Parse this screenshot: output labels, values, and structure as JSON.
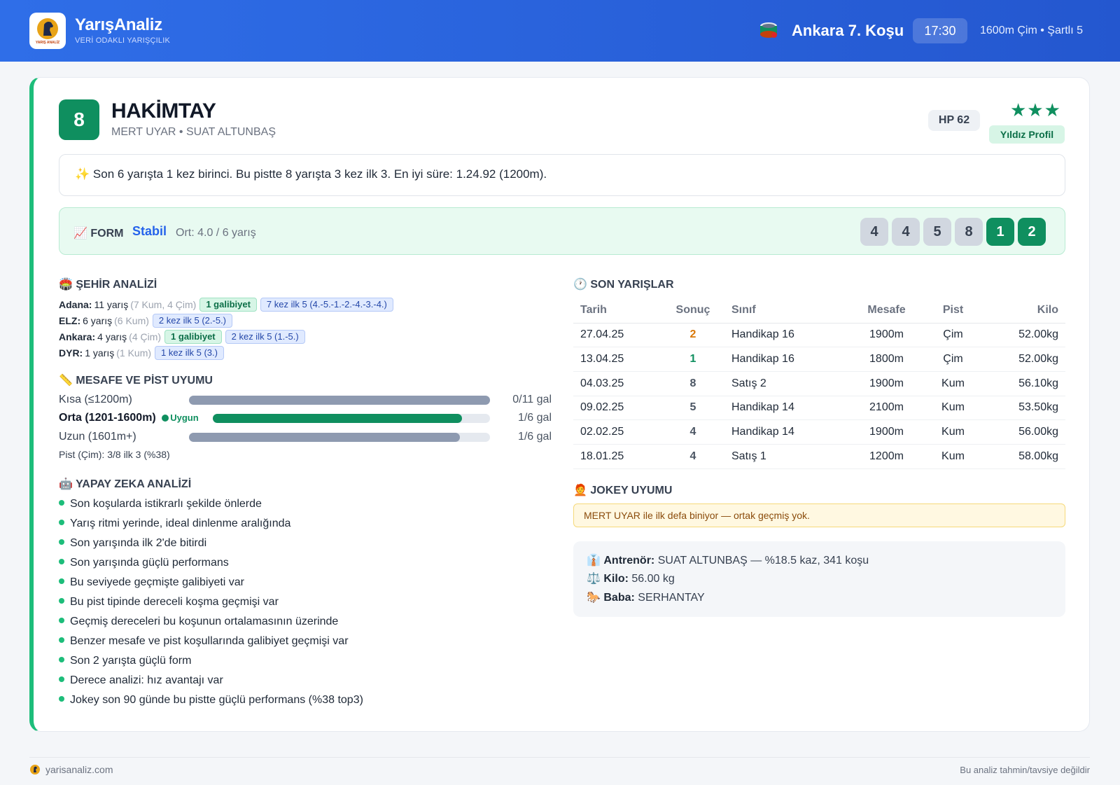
{
  "header": {
    "brand_name": "YarışAnaliz",
    "brand_tagline": "VERİ ODAKLI YARIŞÇILIK",
    "race_title": "Ankara 7. Koşu",
    "race_time": "17:30",
    "race_info": "1600m Çim • Şartlı 5",
    "logo_text": "YARIŞ ANALİZ"
  },
  "horse": {
    "number": "8",
    "name": "HAKİMTAY",
    "jockey_trainer": "MERT UYAR • SUAT ALTUNBAŞ",
    "hp": "HP 62",
    "stars": "★★★",
    "star_count": 3,
    "profile_badge": "Yıldız Profil",
    "summary_icon": "✨",
    "summary": "Son 6 yarışta 1 kez birinci. Bu pistte 8 yarışta 3 kez ilk 3. En iyi süre: 1.24.92 (1200m)."
  },
  "form": {
    "icon": "📈",
    "label": "FORM",
    "status": "Stabil",
    "average": "Ort: 4.0 / 6 yarış",
    "results": [
      "4",
      "4",
      "5",
      "8",
      "1",
      "2"
    ]
  },
  "city_analysis": {
    "icon": "🏟️",
    "title": "ŞEHİR ANALİZİ",
    "rows": [
      {
        "city": "Adana:",
        "races": "11 yarış",
        "detail": "(7 Kum, 4 Çim)",
        "win_tag": "1 galibiyet",
        "top_tag": "7 kez ilk 5 (4.-5.-1.-2.-4.-3.-4.)"
      },
      {
        "city": "ELZ:",
        "races": "6 yarış",
        "detail": "(6 Kum)",
        "win_tag": "",
        "top_tag": "2 kez ilk 5 (2.-5.)"
      },
      {
        "city": "Ankara:",
        "races": "4 yarış",
        "detail": "(4 Çim)",
        "win_tag": "1 galibiyet",
        "top_tag": "2 kez ilk 5 (1.-5.)"
      },
      {
        "city": "DYR:",
        "races": "1 yarış",
        "detail": "(1 Kum)",
        "win_tag": "",
        "top_tag": "1 kez ilk 5 (3.)"
      }
    ]
  },
  "distance": {
    "icon": "📏",
    "title": "MESAFE VE PİST UYUMU",
    "rows": [
      {
        "label": "Kısa (≤1200m)",
        "value": "0/11 gal",
        "fill": 1.0,
        "good": false,
        "badge": ""
      },
      {
        "label": "Orta (1201-1600m)",
        "value": "1/6 gal",
        "fill": 0.9,
        "good": true,
        "badge": "Uygun"
      },
      {
        "label": "Uzun (1601m+)",
        "value": "1/6 gal",
        "fill": 0.9,
        "good": false,
        "badge": ""
      }
    ],
    "pist": "Pist (Çim): 3/8 ilk 3 (%38)"
  },
  "ai": {
    "icon": "🤖",
    "title": "YAPAY ZEKA ANALİZİ",
    "items": [
      "Son koşularda istikrarlı şekilde önlerde",
      "Yarış ritmi yerinde, ideal dinlenme aralığında",
      "Son yarışında ilk 2'de bitirdi",
      "Son yarışında güçlü performans",
      "Bu seviyede geçmişte galibiyeti var",
      "Bu pist tipinde dereceli koşma geçmişi var",
      "Geçmiş dereceleri bu koşunun ortalamasının üzerinde",
      "Benzer mesafe ve pist koşullarında galibiyet geçmişi var",
      "Son 2 yarışta güçlü form",
      "Derece analizi: hız avantajı var",
      "Jokey son 90 günde bu pistte güçlü performans (%38 top3)"
    ]
  },
  "recent": {
    "icon": "🕐",
    "title": "SON YARIŞLAR",
    "headers": [
      "Tarih",
      "Sonuç",
      "Sınıf",
      "Mesafe",
      "Pist",
      "Kilo"
    ],
    "rows": [
      {
        "date": "27.04.25",
        "result": "2",
        "class": "Handikap 16",
        "distance": "1900m",
        "track": "Çim",
        "weight": "52.00kg"
      },
      {
        "date": "13.04.25",
        "result": "1",
        "class": "Handikap 16",
        "distance": "1800m",
        "track": "Çim",
        "weight": "52.00kg"
      },
      {
        "date": "04.03.25",
        "result": "8",
        "class": "Satış 2",
        "distance": "1900m",
        "track": "Kum",
        "weight": "56.10kg"
      },
      {
        "date": "09.02.25",
        "result": "5",
        "class": "Handikap 14",
        "distance": "2100m",
        "track": "Kum",
        "weight": "53.50kg"
      },
      {
        "date": "02.02.25",
        "result": "4",
        "class": "Handikap 14",
        "distance": "1900m",
        "track": "Kum",
        "weight": "56.00kg"
      },
      {
        "date": "18.01.25",
        "result": "4",
        "class": "Satış 1",
        "distance": "1200m",
        "track": "Kum",
        "weight": "58.00kg"
      }
    ]
  },
  "jockey": {
    "icon": "🧑‍🦰",
    "title": "JOKEY UYUMU",
    "note": "MERT UYAR ile ilk defa biniyor — ortak geçmiş yok."
  },
  "details": {
    "trainer_icon": "👔",
    "trainer_label": "Antrenör:",
    "trainer_value": "SUAT ALTUNBAŞ — %18.5 kaz, 341 koşu",
    "weight_icon": "⚖️",
    "weight_label": "Kilo:",
    "weight_value": "56.00 kg",
    "sire_icon": "🐎",
    "sire_label": "Baba:",
    "sire_value": "SERHANTAY"
  },
  "footer": {
    "site": "yarisanaliz.com",
    "disclaimer": "Bu analiz tahmin/tavsiye değildir"
  },
  "colors": {
    "header": "#2f6ee8",
    "accent_green": "#0f8f5f",
    "form_blue": "#2563eb",
    "second_place": "#d97706"
  }
}
